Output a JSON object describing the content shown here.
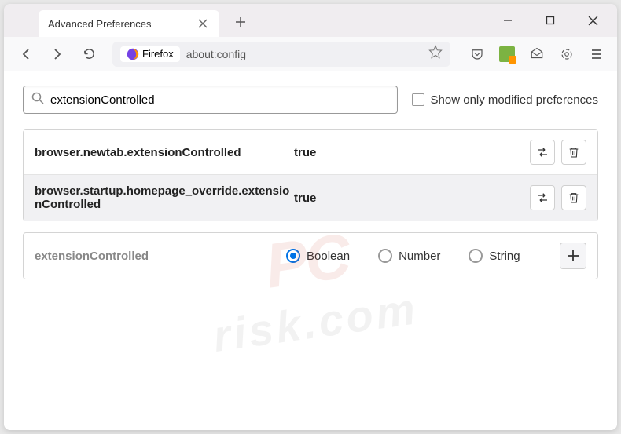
{
  "tab": {
    "title": "Advanced Preferences"
  },
  "urlbar": {
    "identity": "Firefox",
    "url": "about:config"
  },
  "search": {
    "value": "extensionControlled",
    "placeholder": ""
  },
  "checkbox": {
    "label": "Show only modified preferences"
  },
  "prefs": [
    {
      "name": "browser.newtab.extensionControlled",
      "value": "true"
    },
    {
      "name": "browser.startup.homepage_override.extensionControlled",
      "value": "true"
    }
  ],
  "newPref": {
    "name": "extensionControlled",
    "types": [
      "Boolean",
      "Number",
      "String"
    ],
    "selected": "Boolean"
  },
  "watermark": {
    "logo": "PC",
    "text": "risk.com"
  }
}
